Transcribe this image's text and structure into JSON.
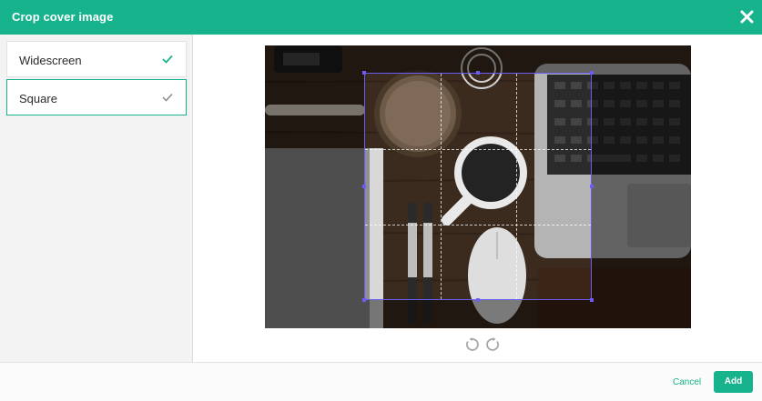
{
  "dialog": {
    "title": "Crop cover image",
    "close_icon": "close-icon"
  },
  "sidebar": {
    "options": [
      {
        "label": "Widescreen",
        "icon": "checkmark-icon",
        "selected": false
      },
      {
        "label": "Square",
        "icon": "checkmark-icon",
        "selected": true
      }
    ]
  },
  "editor": {
    "image_description": "Top-down desk photo with laptop, coffee cup, mouse, pens, notebook, magnifying glass and earphones",
    "rotate_left_icon": "rotate-left-icon",
    "rotate_right_icon": "rotate-right-icon"
  },
  "footer": {
    "cancel_label": "Cancel",
    "add_label": "Add"
  },
  "colors": {
    "accent": "#17b38c",
    "crop_border": "#6a5cf5"
  }
}
